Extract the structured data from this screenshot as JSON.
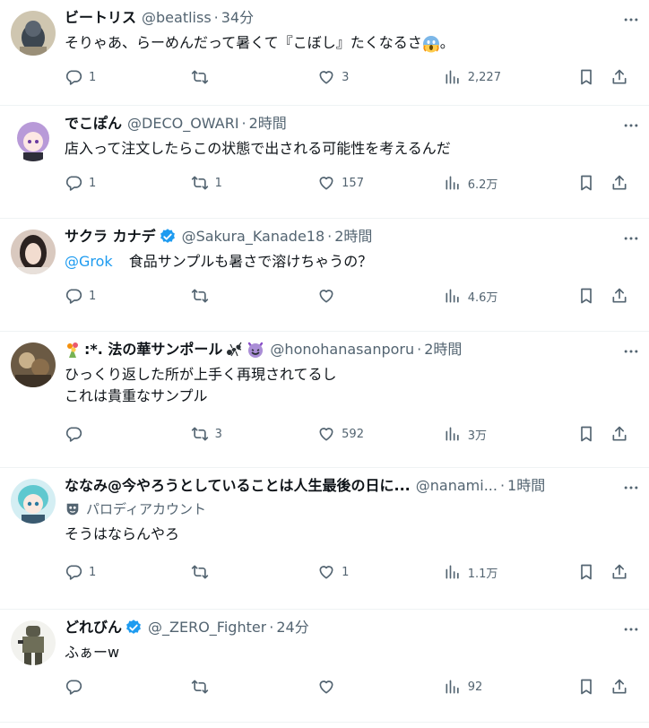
{
  "tweets": [
    {
      "name": "ビートリス",
      "handle": "@beatliss",
      "time": "34分",
      "verified": false,
      "text_before_emoji": "そりゃあ、らーめんだって暑くて『こぼし』たくなるさ",
      "text_after_emoji": "。",
      "emoji": "face-screaming-emoji",
      "replies": "1",
      "retweets": "",
      "likes": "3",
      "views": "2,227"
    },
    {
      "name": "でこぽん",
      "handle": "@DECO_OWARI",
      "time": "2時間",
      "verified": false,
      "text": "店入って注文したらこの状態で出される可能性を考えるんだ",
      "replies": "1",
      "retweets": "1",
      "likes": "157",
      "views": "6.2万"
    },
    {
      "name": "サクラ カナデ",
      "handle": "@Sakura_Kanade18",
      "time": "2時間",
      "verified": true,
      "mention": "@Grok",
      "text": "食品サンプルも暑さで溶けちゃうの？",
      "replies": "1",
      "retweets": "",
      "likes": "",
      "views": "4.6万"
    },
    {
      "name": ":*. 法の華サンポール",
      "handle": "@honohanasanporu",
      "time": "2時間",
      "verified": false,
      "text_line1": "ひっくり返した所が上手く再現されてるし",
      "text_line2": "これは貴重なサンプル",
      "replies": "",
      "retweets": "3",
      "likes": "592",
      "views": "3万"
    },
    {
      "name": "ななみ@今やろうとしていることは人生最後の日に...",
      "handle": "@nanami...",
      "time": "1時間",
      "verified": false,
      "parody_label": "パロディアカウント",
      "text": "そうはならんやろ",
      "replies": "1",
      "retweets": "",
      "likes": "1",
      "views": "1.1万"
    },
    {
      "name": "どれびん",
      "handle": "@_ZERO_Fighter",
      "time": "24分",
      "verified": true,
      "text": "ふぁーw",
      "replies": "",
      "retweets": "",
      "likes": "",
      "views": "92"
    }
  ],
  "separator": "·",
  "colors": {
    "accent": "#1d9bf0",
    "secondary": "#536471",
    "text": "#0f1419"
  }
}
